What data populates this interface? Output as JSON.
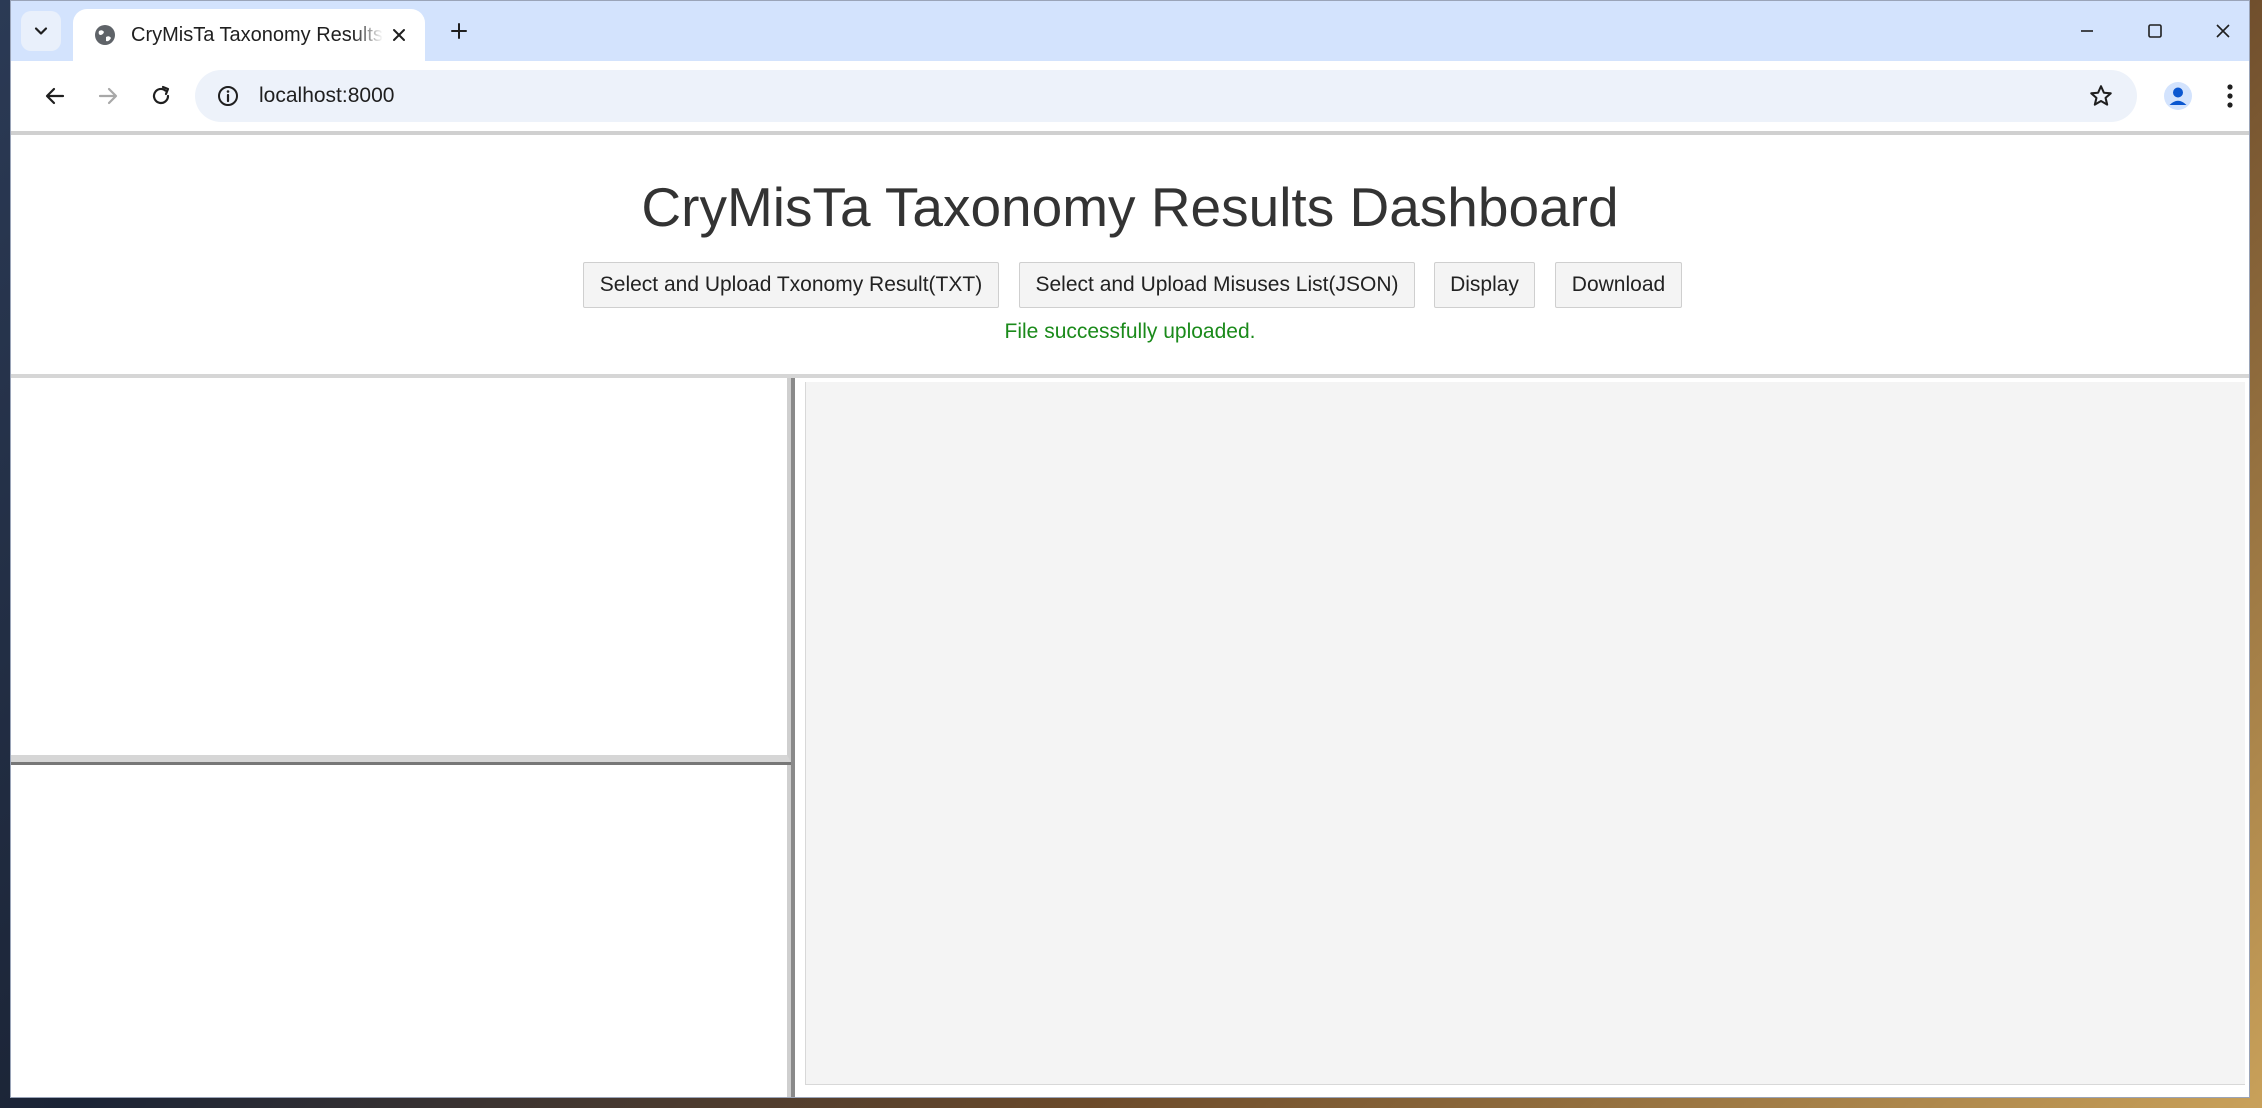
{
  "browser": {
    "tab": {
      "title": "CryMisTa Taxonomy Results Dashboard"
    },
    "address_bar": {
      "url": "localhost:8000"
    }
  },
  "page": {
    "title": "CryMisTa Taxonomy Results Dashboard",
    "buttons": {
      "upload_txt": "Select and Upload Txonomy Result(TXT)",
      "upload_json": "Select and Upload Misuses List(JSON)",
      "display": "Display",
      "download": "Download"
    },
    "status_message": "File successfully uploaded."
  },
  "colors": {
    "status_success": "#1a8a1a",
    "tabstrip": "#d3e3fd",
    "omnibox": "#edf2fa",
    "panel_right_bg": "#f4f4f4"
  }
}
